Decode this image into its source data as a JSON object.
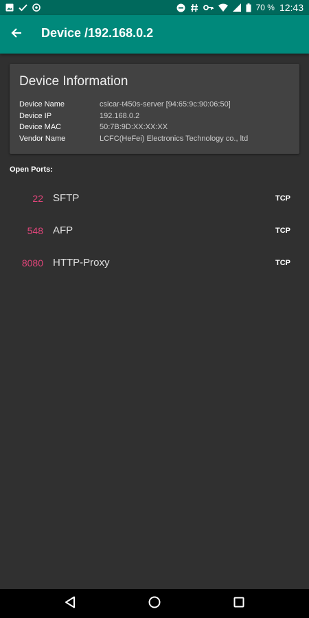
{
  "status_bar": {
    "battery": "70 %",
    "time": "12:43",
    "icons_left": [
      "image-icon",
      "check-icon",
      "block-icon"
    ],
    "icons_right": [
      "dnd-icon",
      "hash-icon",
      "key-icon",
      "wifi-icon",
      "signal-icon",
      "battery-icon"
    ]
  },
  "app_bar": {
    "title": "Device /192.168.0.2",
    "back_icon": "arrow-back-icon",
    "color": "#00897b"
  },
  "device_info": {
    "title": "Device Information",
    "rows": [
      {
        "label": "Device Name",
        "value": "csicar-t450s-server [94:65:9c:90:06:50]"
      },
      {
        "label": "Device IP",
        "value": "192.168.0.2"
      },
      {
        "label": "Device MAC",
        "value": "50:7B:9D:XX:XX:XX"
      },
      {
        "label": "Vendor Name",
        "value": "LCFC(HeFei) Electronics Technology co., ltd"
      }
    ]
  },
  "open_ports": {
    "label": "Open Ports:",
    "items": [
      {
        "port": "22",
        "service": "SFTP",
        "protocol": "TCP"
      },
      {
        "port": "548",
        "service": "AFP",
        "protocol": "TCP"
      },
      {
        "port": "8080",
        "service": "HTTP-Proxy",
        "protocol": "TCP"
      }
    ],
    "port_color": "#e0457a"
  },
  "nav_bar": {
    "buttons": [
      "back-nav-icon",
      "home-nav-icon",
      "recents-nav-icon"
    ]
  }
}
